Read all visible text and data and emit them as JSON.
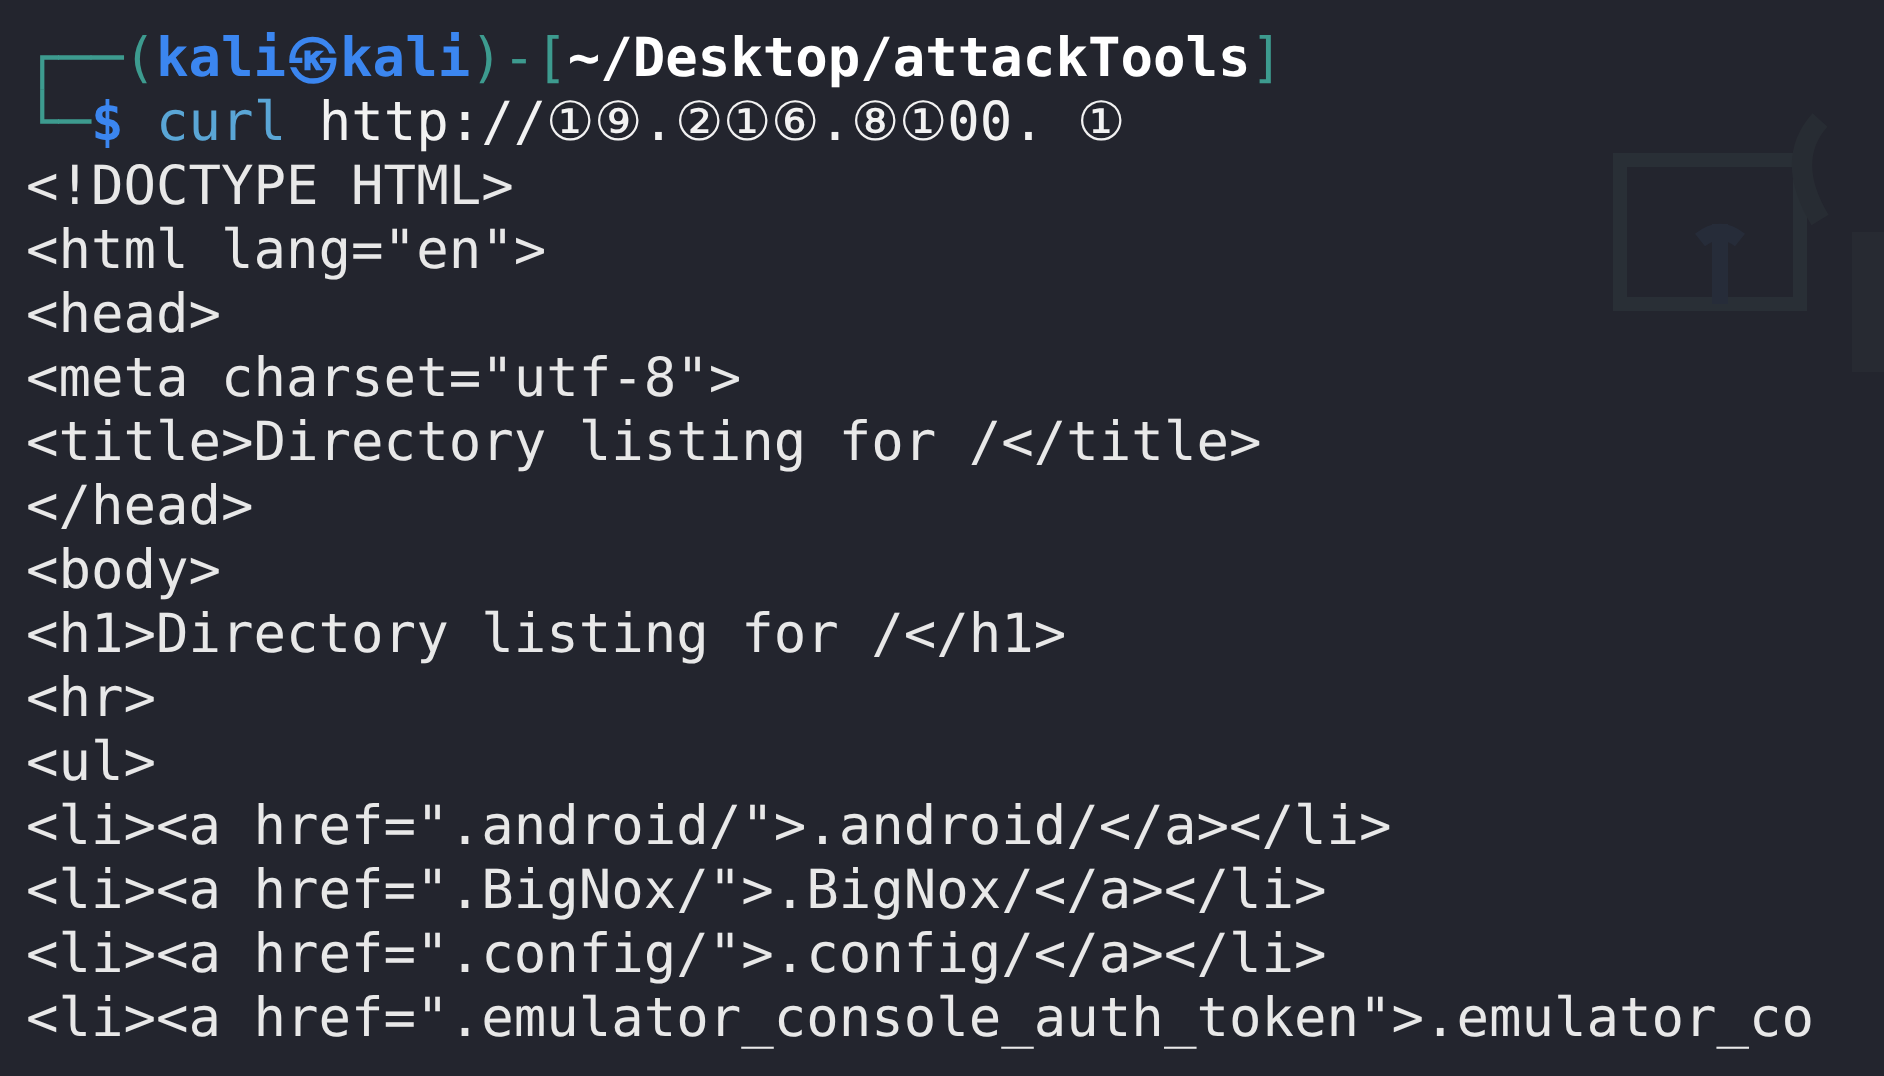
{
  "prompt": {
    "corner": "┌──(",
    "user_host": "kali㉿kali",
    "bracket_open": ")-[",
    "cwd": "~/Desktop/attackTools",
    "bracket_close": "]"
  },
  "command": {
    "corner": "└─",
    "symbol": "$",
    "program": "curl",
    "args": "http://①⑨.②①⑥.⑧①00. ①"
  },
  "output": [
    "<!DOCTYPE HTML>",
    "<html lang=\"en\">",
    "<head>",
    "<meta charset=\"utf-8\">",
    "<title>Directory listing for /</title>",
    "</head>",
    "<body>",
    "<h1>Directory listing for /</h1>",
    "<hr>",
    "<ul>",
    "<li><a href=\".android/\">.android/</a></li>",
    "<li><a href=\".BigNox/\">.BigNox/</a></li>",
    "<li><a href=\".config/\">.config/</a></li>",
    "<li><a href=\".emulator_console_auth_token\">.emulator_co"
  ]
}
